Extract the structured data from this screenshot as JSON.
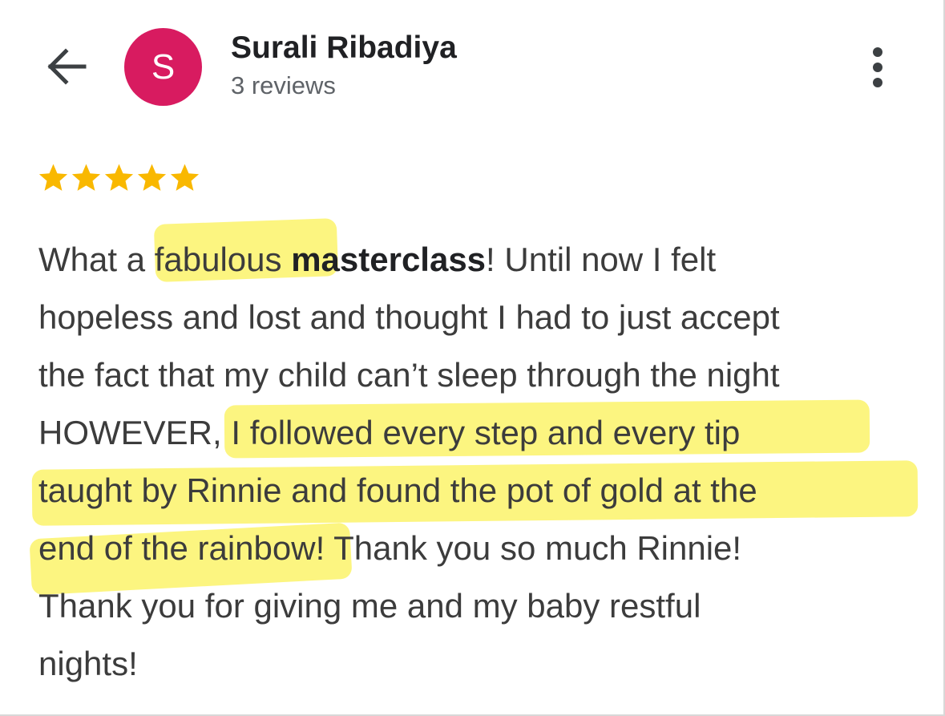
{
  "header": {
    "back_icon": "arrow-left-icon",
    "avatar_letter": "S",
    "avatar_color": "#d81b60",
    "reviewer_name": "Surali Ribadiya",
    "review_count": "3 reviews",
    "more_icon": "more-vertical-icon"
  },
  "review": {
    "rating": 5,
    "max_rating": 5,
    "star_color": "#f9b800",
    "highlight_color": "#fbf36a",
    "lines": [
      [
        "What a fabulous ",
        "masterclass",
        "! Until now I felt"
      ],
      [
        "hopeless and lost and thought I had to just accept"
      ],
      [
        "the fact that my child can’t sleep through the night"
      ],
      [
        "HOWEVER, I followed every step and every tip"
      ],
      [
        "taught by Rinnie and found the pot of gold at the"
      ],
      [
        "end of the rainbow! Thank you so much Rinnie!"
      ],
      [
        "Thank you for giving me and my baby restful"
      ],
      [
        "nights!"
      ]
    ]
  }
}
